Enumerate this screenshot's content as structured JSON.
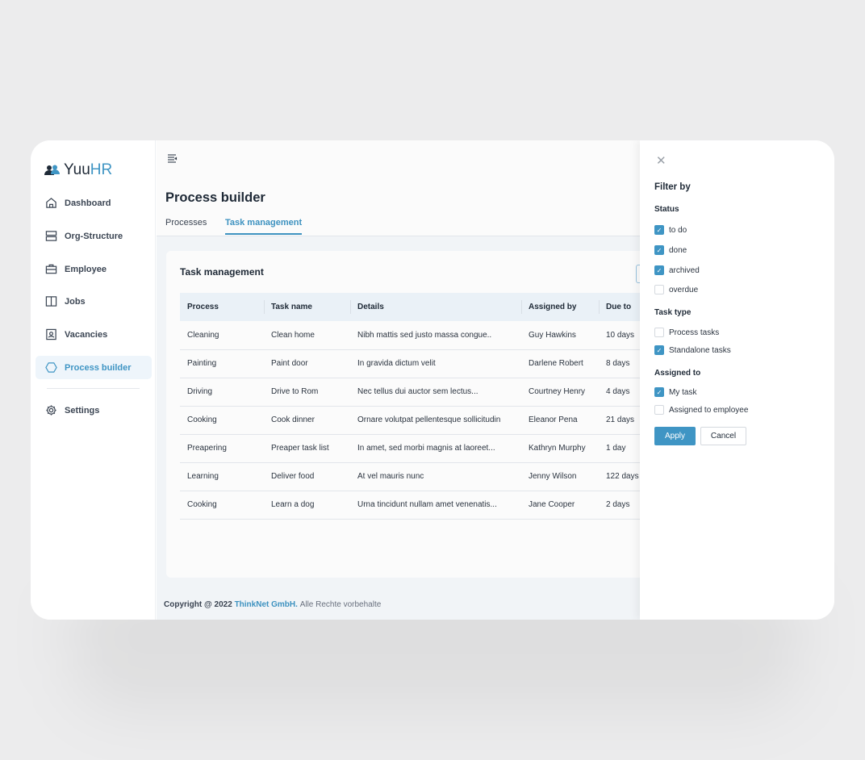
{
  "brand": {
    "name_a": "Yuu",
    "name_b": "HR"
  },
  "sidebar": {
    "items": [
      {
        "label": "Dashboard",
        "icon": "home-icon"
      },
      {
        "label": "Org-Structure",
        "icon": "server-icon"
      },
      {
        "label": "Employee",
        "icon": "briefcase-icon"
      },
      {
        "label": "Jobs",
        "icon": "book-icon"
      },
      {
        "label": "Vacancies",
        "icon": "badge-icon"
      },
      {
        "label": "Process builder",
        "icon": "hexagon-icon",
        "active": true
      },
      {
        "label": "Settings",
        "icon": "gear-icon"
      }
    ]
  },
  "header": {
    "title": "Process builder",
    "tabs": [
      {
        "label": "Processes"
      },
      {
        "label": "Task management",
        "active": true
      }
    ]
  },
  "card": {
    "title": "Task management"
  },
  "table": {
    "columns": [
      "Process",
      "Task name",
      "Details",
      "Assigned by",
      "Due to"
    ],
    "rows": [
      [
        "Cleaning",
        "Clean home",
        "Nibh mattis sed justo massa congue..",
        "Guy Hawkins",
        "10 days"
      ],
      [
        "Painting",
        "Paint door",
        "In gravida dictum velit",
        "Darlene Robert",
        "8 days"
      ],
      [
        "Driving",
        "Drive to Rom",
        "Nec tellus dui auctor sem lectus...",
        "Courtney Henry",
        "4 days"
      ],
      [
        "Cooking",
        "Cook dinner",
        "Ornare volutpat pellentesque sollicitudin",
        "Eleanor Pena",
        "21 days"
      ],
      [
        "Preapering",
        "Preaper task list",
        "In amet, sed morbi magnis at laoreet...",
        "Kathryn Murphy",
        "1 day"
      ],
      [
        "Learning",
        "Deliver food",
        "At vel mauris nunc",
        "Jenny Wilson",
        "122 days"
      ],
      [
        "Cooking",
        "Learn a dog",
        "Urna tincidunt nullam amet venenatis...",
        "Jane Cooper",
        "2 days"
      ]
    ]
  },
  "footer": {
    "prefix": "Copyright @ 2022",
    "company": "ThinkNet GmbH.",
    "rest": "Alle Rechte vorbehalte"
  },
  "filter": {
    "title": "Filter by",
    "status": {
      "label": "Status",
      "options": [
        {
          "label": "to do",
          "checked": true
        },
        {
          "label": "done",
          "checked": true
        },
        {
          "label": "archived",
          "checked": true
        },
        {
          "label": "overdue",
          "checked": false
        }
      ]
    },
    "task_type": {
      "label": "Task type",
      "options": [
        {
          "label": "Process tasks",
          "checked": false
        },
        {
          "label": "Standalone tasks",
          "checked": true
        }
      ]
    },
    "assigned": {
      "label": "Assigned to",
      "options": [
        {
          "label": "My task",
          "checked": true
        },
        {
          "label": "Assigned to employee",
          "checked": false
        }
      ]
    },
    "apply": "Apply",
    "cancel": "Cancel"
  },
  "colors": {
    "accent": "#3f95c4"
  }
}
